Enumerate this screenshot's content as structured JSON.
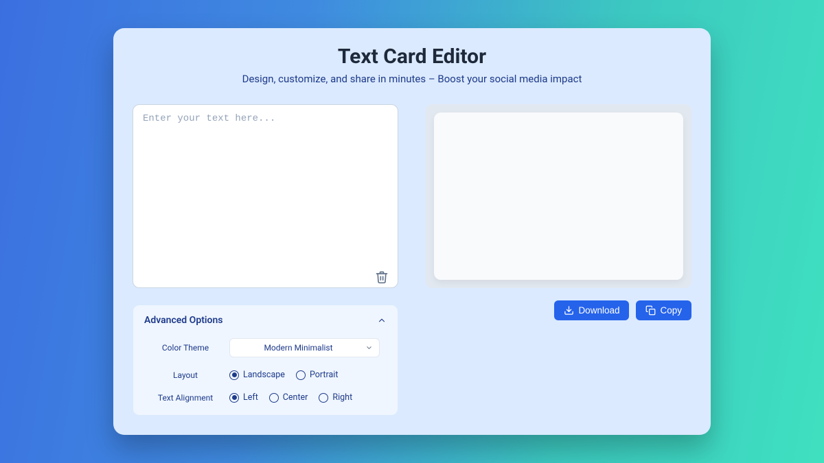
{
  "header": {
    "title": "Text Card Editor",
    "subtitle": "Design, customize, and share in minutes – Boost your social media impact"
  },
  "editor": {
    "placeholder": "Enter your text here...",
    "value": ""
  },
  "actions": {
    "download_label": "Download",
    "copy_label": "Copy"
  },
  "advanced": {
    "title": "Advanced Options",
    "color_theme_label": "Color Theme",
    "color_theme_selected": "Modern Minimalist",
    "layout_label": "Layout",
    "layout_options": {
      "landscape": "Landscape",
      "portrait": "Portrait"
    },
    "layout_selected": "landscape",
    "alignment_label": "Text Alignment",
    "alignment_options": {
      "left": "Left",
      "center": "Center",
      "right": "Right"
    },
    "alignment_selected": "left"
  }
}
